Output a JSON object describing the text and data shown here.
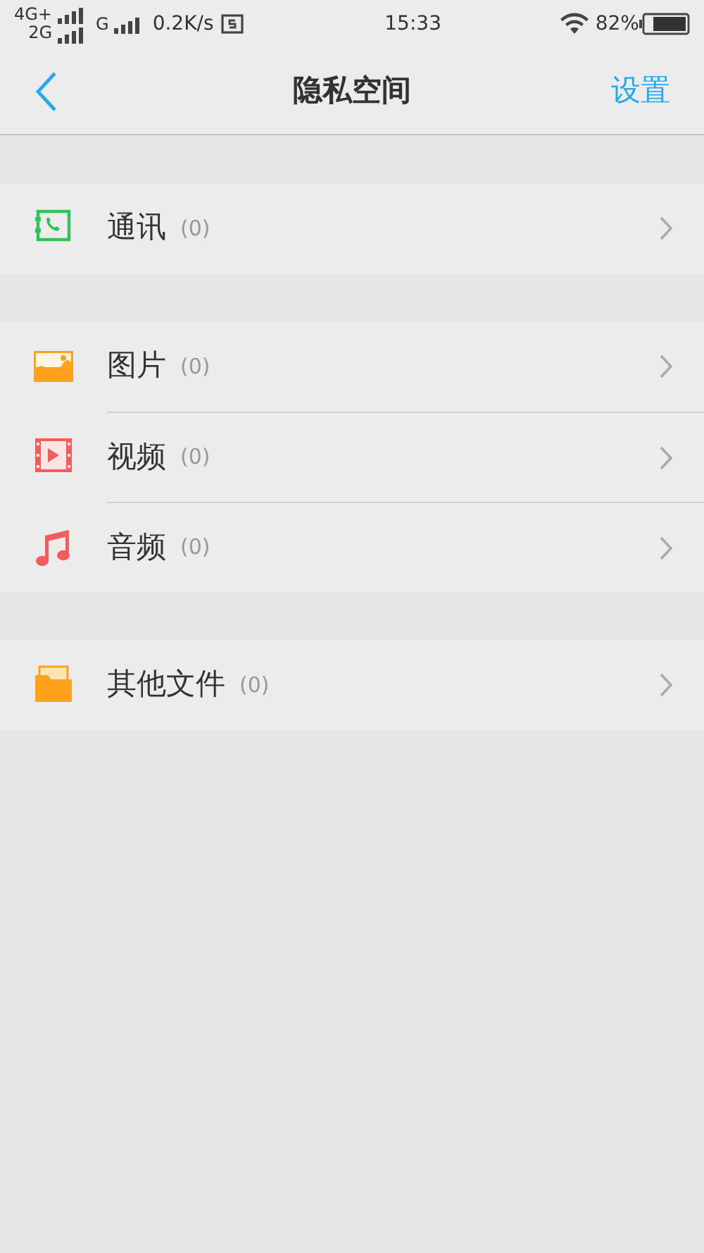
{
  "status_bar": {
    "network_top": "4G+",
    "network_bottom": "2G",
    "network_second": "G",
    "speed": "0.2K/s",
    "time": "15:33",
    "battery": "82%"
  },
  "header": {
    "title": "隐私空间",
    "action": "设置"
  },
  "groups": [
    {
      "items": [
        {
          "kind": "contacts",
          "label": "通讯",
          "count": "(0)"
        }
      ]
    },
    {
      "items": [
        {
          "kind": "pictures",
          "label": "图片",
          "count": "(0)"
        },
        {
          "kind": "video",
          "label": "视频",
          "count": "(0)"
        },
        {
          "kind": "audio",
          "label": "音频",
          "count": "(0)"
        }
      ]
    },
    {
      "items": [
        {
          "kind": "files",
          "label": "其他文件",
          "count": "(0)"
        }
      ]
    }
  ]
}
